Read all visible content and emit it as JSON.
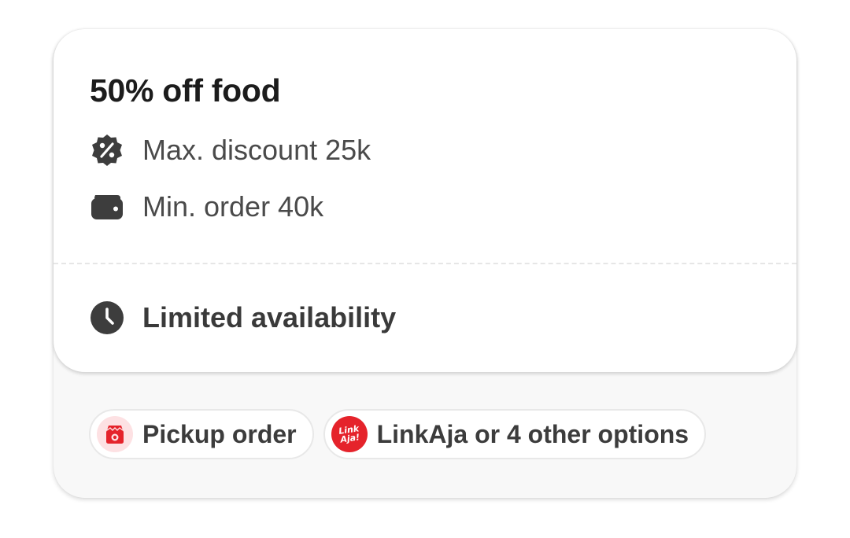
{
  "offer": {
    "title": "50% off food",
    "max_discount": "Max. discount 25k",
    "min_order": "Min. order 40k",
    "availability": "Limited availability"
  },
  "chips": {
    "pickup_label": "Pickup order",
    "payment_label": "LinkAja or 4 other options",
    "linkaja_logo_line1": "Link",
    "linkaja_logo_line2": "Aja!"
  },
  "icons": {
    "discount": "discount-badge-icon",
    "wallet": "wallet-icon",
    "clock": "clock-icon",
    "pickup": "pickup-bag-icon",
    "linkaja": "linkaja-logo"
  },
  "colors": {
    "brand_red": "#e5232b",
    "pickup_bg": "#fde1e3",
    "text_dark": "#1c1c1c",
    "text_body": "#4a4a4a"
  }
}
